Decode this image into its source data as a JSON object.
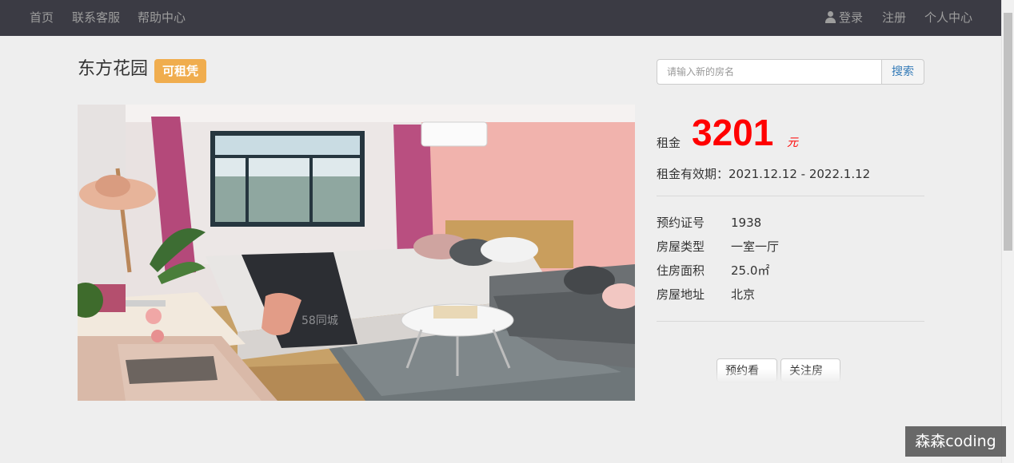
{
  "nav": {
    "home": "首页",
    "contact": "联系客服",
    "help": "帮助中心",
    "login": "登录",
    "register": "注册",
    "profile": "个人中心"
  },
  "house": {
    "name": "东方花园",
    "status_badge": "可租凭"
  },
  "search": {
    "placeholder": "请输入新的房名",
    "button_label": "搜索"
  },
  "price": {
    "label": "租金",
    "value": "3201",
    "unit": "元"
  },
  "validity": "租金有效期：2021.12.12 - 2022.1.12",
  "details": [
    {
      "label": "预约证号",
      "value": "1938"
    },
    {
      "label": "房屋类型",
      "value": "一室一厅"
    },
    {
      "label": "住房面积",
      "value": "25.0㎡"
    },
    {
      "label": "房屋地址",
      "value": "北京"
    }
  ],
  "actions": {
    "appointment": "预约看房",
    "follow": "关注房源"
  },
  "photo_watermark": "58同城",
  "corner_watermark": "森森coding",
  "colors": {
    "navbar": "#3b3b44",
    "badge": "#f0ad4e",
    "price": "#ff0000",
    "link": "#337ab7"
  }
}
